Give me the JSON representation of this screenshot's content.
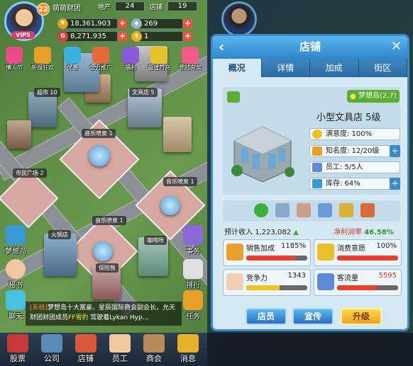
{
  "player": {
    "level": "22",
    "vip": "VIP5",
    "company": "萌萌财团"
  },
  "topbar": {
    "land_label": "地产",
    "land_value": "24",
    "shop_label": "店铺",
    "shop_value": "19"
  },
  "resources": {
    "cash": "18,361,903",
    "assets": "8,271,935",
    "gems": "269",
    "tokens": "1"
  },
  "events": [
    "情人节",
    "新服狂欢",
    "优惠",
    "全力推广",
    "福利",
    "超值首充",
    "登陆有奖"
  ],
  "map_signs": {
    "supermarket": "超市 10",
    "stationery": "文具店 5",
    "fountain1": "音乐喷泉 1",
    "square": "市民广场 2",
    "fountain2": "音乐喷泉 1",
    "fountain3": "音乐喷泉 1",
    "fire": "火锅店",
    "coffee": "咖啡所",
    "insurance": "保险售"
  },
  "left_side": {
    "dreamisland": "梦想岛",
    "secretary": "秘书",
    "chat": "聊天"
  },
  "right_side": {
    "events": "事务",
    "rank": "排行",
    "tasks": "任务"
  },
  "chat": {
    "tag": "[系统]",
    "message": "梦想岛十大富豪、星辰国际商会副会长，允天财团财团成员",
    "highlight": "FF雪豹",
    "tail": "驾驶着Lykan Hyp..."
  },
  "bottom_nav": [
    "股票",
    "公司",
    "店铺",
    "员工",
    "商会",
    "消息"
  ],
  "dialog": {
    "title": "店铺",
    "tabs": [
      "概况",
      "详情",
      "加成",
      "街区"
    ],
    "location": "梦想岛(2,7)",
    "shop_name": "小型文具店 5级",
    "info": [
      {
        "label": "满意度: 100%",
        "has_plus": false
      },
      {
        "label": "知名度: 12/20级",
        "has_plus": true
      },
      {
        "label": "员工: 5/5人",
        "has_plus": false
      },
      {
        "label": "库存: 64%",
        "has_plus": true
      }
    ],
    "expected_income_label": "预计收入",
    "expected_income": "1,223,082",
    "profit_label": "净利润率",
    "profit": "46.58%",
    "metrics": [
      {
        "label": "销售加成",
        "value": "1185%",
        "fill": 0.8,
        "color": "#e8402a"
      },
      {
        "label": "消费意愿",
        "value": "100%",
        "fill": 1.0,
        "color": "#e8402a"
      },
      {
        "label": "竞争力",
        "value": "1343",
        "fill": 0.55,
        "color": "#f0c020"
      },
      {
        "label": "客流量",
        "value": "5595",
        "fill": 0.65,
        "color": "#e8402a"
      }
    ],
    "buttons": [
      "店员",
      "宣传",
      "升级"
    ]
  },
  "colors": {
    "accent": "#2e86cc",
    "red": "#e8402a",
    "green": "#5ab02e"
  }
}
